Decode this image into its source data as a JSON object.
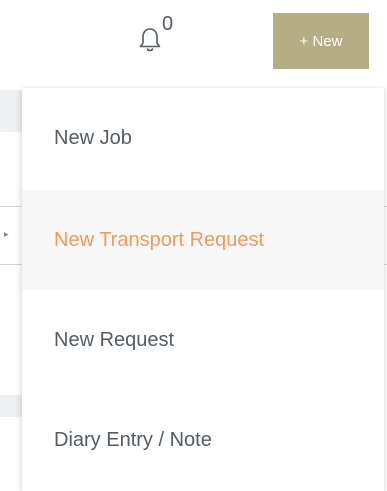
{
  "header": {
    "notifications": {
      "icon": "bell-icon",
      "count": "0"
    },
    "new_button_label": "+ New"
  },
  "new_menu": {
    "items": [
      {
        "label": "New Job",
        "highlighted": false
      },
      {
        "label": "New Transport Request",
        "highlighted": true
      },
      {
        "label": "New Request",
        "highlighted": false
      },
      {
        "label": "Diary Entry / Note",
        "highlighted": false
      }
    ]
  },
  "colors": {
    "new_button_bg": "#b5ae84",
    "highlight_text": "#f29a5e",
    "text": "#555c63"
  }
}
